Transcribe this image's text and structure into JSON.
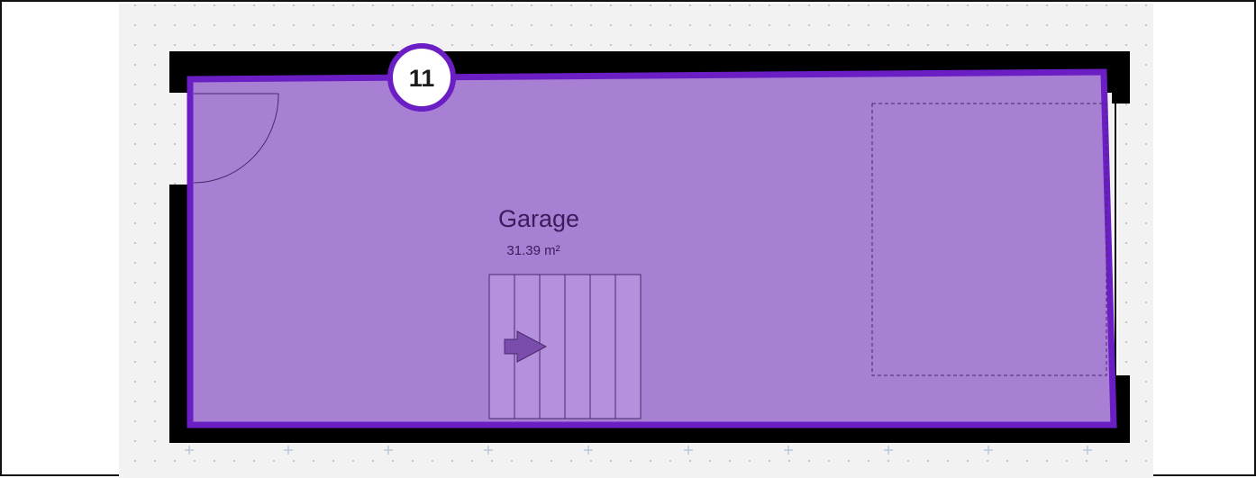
{
  "room": {
    "name": "Garage",
    "area": "31.39 m²",
    "badge_number": "11"
  },
  "colors": {
    "room_fill": "#a77fd3",
    "room_outline": "#6a1ec4",
    "wall": "#000000",
    "stairs_arrow": "#7a4cab",
    "grid_background": "#f2f2f2",
    "text": "#3d1b5c"
  },
  "icons": {
    "stairs_direction": "arrow-right-icon",
    "grid_marker": "plus-icon"
  }
}
